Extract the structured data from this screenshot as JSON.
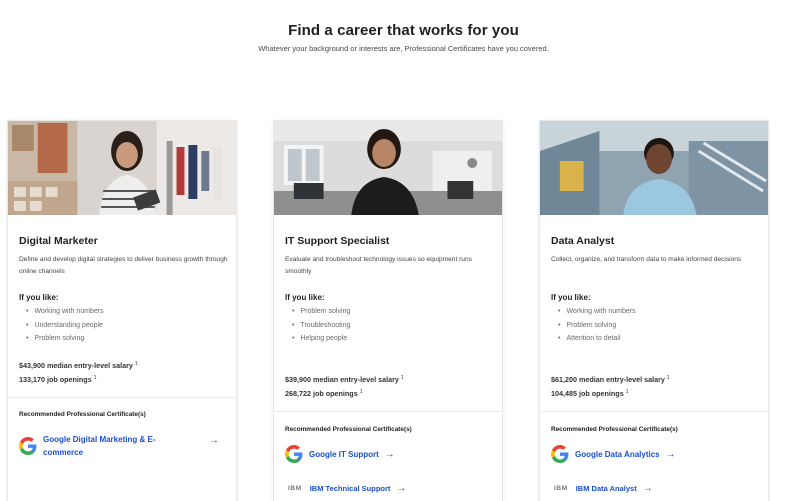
{
  "header": {
    "title": "Find a career that works for you",
    "subtitle": "Whatever your background or interests are, Professional Certificates have you covered."
  },
  "common": {
    "if_you_like": "If you like:",
    "recommended": "Recommended Professional Certificate(s)",
    "arrow": "→",
    "ibm_logo": "IBM"
  },
  "cards": [
    {
      "title": "Digital Marketer",
      "description": "Define and develop digital strategies to deliver business growth through online channels",
      "likes": [
        "Working with numbers",
        "Understanding people",
        "Problem solving"
      ],
      "salary": "$43,900 median entry-level salary",
      "jobs": "133,170 job openings",
      "certs": [
        {
          "label": "Google Digital Marketing & E-commerce",
          "provider": "google"
        }
      ]
    },
    {
      "title": "IT Support Specialist",
      "description": "Evaluate and troubleshoot technology issues so equipment runs smoothly",
      "likes": [
        "Problem solving",
        "Troubleshooting",
        "Helping people"
      ],
      "salary": "$39,900 median entry-level salary",
      "jobs": "268,722 job openings",
      "certs": [
        {
          "label": "Google IT Support",
          "provider": "google"
        },
        {
          "label": "IBM Technical Support",
          "provider": "ibm"
        }
      ]
    },
    {
      "title": "Data Analyst",
      "description": "Collect, organize, and transform data to make informed decisions",
      "likes": [
        "Working with numbers",
        "Problem solving",
        "Attention to detail"
      ],
      "salary": "$61,200 median entry-level salary",
      "jobs": "104,485 job openings",
      "certs": [
        {
          "label": "Google Data Analytics",
          "provider": "google"
        },
        {
          "label": "IBM Data Analyst",
          "provider": "ibm"
        }
      ]
    }
  ],
  "footnote_mark": "1",
  "colors": {
    "link": "#1a4fd0",
    "google_blue": "#4285F4",
    "google_red": "#EA4335",
    "google_yellow": "#FBBC05",
    "google_green": "#34A853"
  }
}
